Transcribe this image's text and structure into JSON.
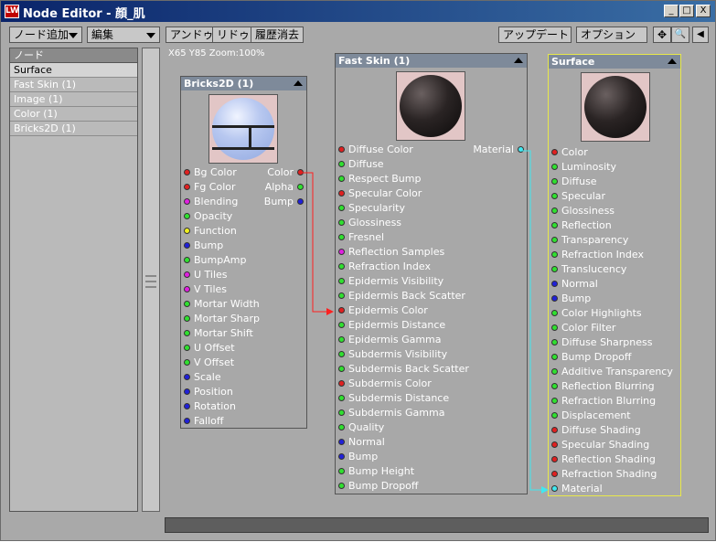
{
  "window": {
    "title": "Node Editor - 顔_肌",
    "icon_text": "LW",
    "minimize_glyph": "_",
    "maximize_glyph": "□",
    "close_glyph": "X"
  },
  "toolbar": {
    "add_node": "ノード追加",
    "edit": "編集",
    "undo": "アンドゥ",
    "redo": "リドゥ",
    "history_clear": "履歴消去",
    "update": "アップデート",
    "options": "オプション",
    "pan_glyph": "✥",
    "zoom_glyph": "🔍",
    "collapse_glyph": "◀"
  },
  "node_list": {
    "header": "ノード",
    "items": [
      "Surface",
      "Fast Skin (1)",
      "Image (1)",
      "Color (1)",
      "Bricks2D (1)"
    ]
  },
  "canvas": {
    "zoom_label": "X65 Y85 Zoom:100%"
  },
  "nodes": {
    "bricks": {
      "title": "Bricks2D (1)",
      "inputs": [
        {
          "label": "Bg Color",
          "color": "#e02020"
        },
        {
          "label": "Fg Color",
          "color": "#e02020"
        },
        {
          "label": "Blending",
          "color": "#e020e0"
        },
        {
          "label": "Opacity",
          "color": "#30e030"
        },
        {
          "label": "Function",
          "color": "#f0f020"
        },
        {
          "label": "Bump",
          "color": "#2020d8"
        },
        {
          "label": "BumpAmp",
          "color": "#30e030"
        },
        {
          "label": "U Tiles",
          "color": "#e020e0"
        },
        {
          "label": "V Tiles",
          "color": "#e020e0"
        },
        {
          "label": "Mortar Width",
          "color": "#30e030"
        },
        {
          "label": "Mortar Sharp",
          "color": "#30e030"
        },
        {
          "label": "Mortar Shift",
          "color": "#30e030"
        },
        {
          "label": "U Offset",
          "color": "#30e030"
        },
        {
          "label": "V Offset",
          "color": "#30e030"
        },
        {
          "label": "Scale",
          "color": "#2020d8"
        },
        {
          "label": "Position",
          "color": "#2020d8"
        },
        {
          "label": "Rotation",
          "color": "#2020d8"
        },
        {
          "label": "Falloff",
          "color": "#2020d8"
        }
      ],
      "outputs": [
        {
          "label": "Color",
          "color": "#e02020"
        },
        {
          "label": "Alpha",
          "color": "#30e030"
        },
        {
          "label": "Bump",
          "color": "#2020d8"
        }
      ]
    },
    "fastskin": {
      "title": "Fast Skin (1)",
      "inputs": [
        {
          "label": "Diffuse Color",
          "color": "#e02020"
        },
        {
          "label": "Diffuse",
          "color": "#30e030"
        },
        {
          "label": "Respect Bump",
          "color": "#30e030"
        },
        {
          "label": "Specular Color",
          "color": "#e02020"
        },
        {
          "label": "Specularity",
          "color": "#30e030"
        },
        {
          "label": "Glossiness",
          "color": "#30e030"
        },
        {
          "label": "Fresnel",
          "color": "#30e030"
        },
        {
          "label": "Reflection Samples",
          "color": "#e020e0"
        },
        {
          "label": "Refraction Index",
          "color": "#30e030"
        },
        {
          "label": "Epidermis Visibility",
          "color": "#30e030"
        },
        {
          "label": "Epidermis Back Scatter",
          "color": "#30e030"
        },
        {
          "label": "Epidermis Color",
          "color": "#e02020"
        },
        {
          "label": "Epidermis Distance",
          "color": "#30e030"
        },
        {
          "label": "Epidermis Gamma",
          "color": "#30e030"
        },
        {
          "label": "Subdermis Visibility",
          "color": "#30e030"
        },
        {
          "label": "Subdermis Back Scatter",
          "color": "#30e030"
        },
        {
          "label": "Subdermis Color",
          "color": "#e02020"
        },
        {
          "label": "Subdermis Distance",
          "color": "#30e030"
        },
        {
          "label": "Subdermis Gamma",
          "color": "#30e030"
        },
        {
          "label": "Quality",
          "color": "#30e030"
        },
        {
          "label": "Normal",
          "color": "#2020d8"
        },
        {
          "label": "Bump",
          "color": "#2020d8"
        },
        {
          "label": "Bump Height",
          "color": "#30e030"
        },
        {
          "label": "Bump Dropoff",
          "color": "#30e030"
        }
      ],
      "outputs": [
        {
          "label": "Material",
          "color": "#40e8f0"
        }
      ]
    },
    "surface": {
      "title": "Surface",
      "inputs": [
        {
          "label": "Color",
          "color": "#e02020"
        },
        {
          "label": "Luminosity",
          "color": "#30e030"
        },
        {
          "label": "Diffuse",
          "color": "#30e030"
        },
        {
          "label": "Specular",
          "color": "#30e030"
        },
        {
          "label": "Glossiness",
          "color": "#30e030"
        },
        {
          "label": "Reflection",
          "color": "#30e030"
        },
        {
          "label": "Transparency",
          "color": "#30e030"
        },
        {
          "label": "Refraction Index",
          "color": "#30e030"
        },
        {
          "label": "Translucency",
          "color": "#30e030"
        },
        {
          "label": "Normal",
          "color": "#2020d8"
        },
        {
          "label": "Bump",
          "color": "#2020d8"
        },
        {
          "label": "Color Highlights",
          "color": "#30e030"
        },
        {
          "label": "Color Filter",
          "color": "#30e030"
        },
        {
          "label": "Diffuse Sharpness",
          "color": "#30e030"
        },
        {
          "label": "Bump Dropoff",
          "color": "#30e030"
        },
        {
          "label": "Additive Transparency",
          "color": "#30e030"
        },
        {
          "label": "Reflection Blurring",
          "color": "#30e030"
        },
        {
          "label": "Refraction Blurring",
          "color": "#30e030"
        },
        {
          "label": "Displacement",
          "color": "#30e030"
        },
        {
          "label": "Diffuse Shading",
          "color": "#e02020"
        },
        {
          "label": "Specular Shading",
          "color": "#e02020"
        },
        {
          "label": "Reflection Shading",
          "color": "#e02020"
        },
        {
          "label": "Refraction Shading",
          "color": "#e02020"
        },
        {
          "label": "Material",
          "color": "#40e8f0"
        }
      ]
    }
  },
  "colors": {
    "connection_color": "#ff2020",
    "connection_material": "#40e8f0",
    "selected_border": "#e8e84a"
  }
}
